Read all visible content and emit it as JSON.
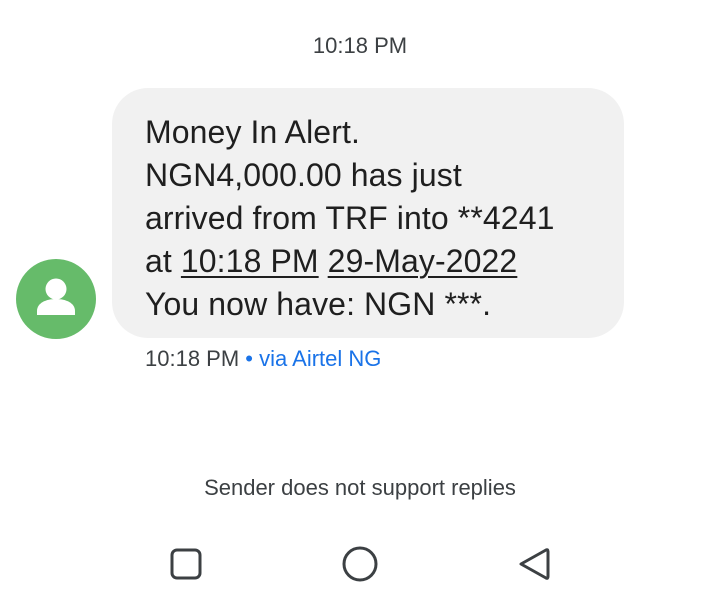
{
  "conversation": {
    "top_timestamp": "10:18 PM",
    "message": {
      "lines": [
        "Money In Alert.",
        "NGN4,000.00 has just",
        "arrived from TRF into **4241",
        "You now have: NGN ***."
      ],
      "line4_prefix": "at",
      "time_link": "10:18 PM",
      "date_link": "29-May-2022",
      "sent_time": "10:18 PM",
      "separator": "•",
      "via": "via Airtel NG"
    },
    "footer_note": "Sender does not support replies"
  },
  "avatar": {
    "icon": "person-icon",
    "color": "#66bb6a"
  },
  "navbar": {
    "recents_icon": "square-icon",
    "home_icon": "circle-icon",
    "back_icon": "triangle-back-icon"
  },
  "colors": {
    "bubble": "#f1f1f1",
    "link": "#1a73e8",
    "text": "#1f1f1f"
  }
}
